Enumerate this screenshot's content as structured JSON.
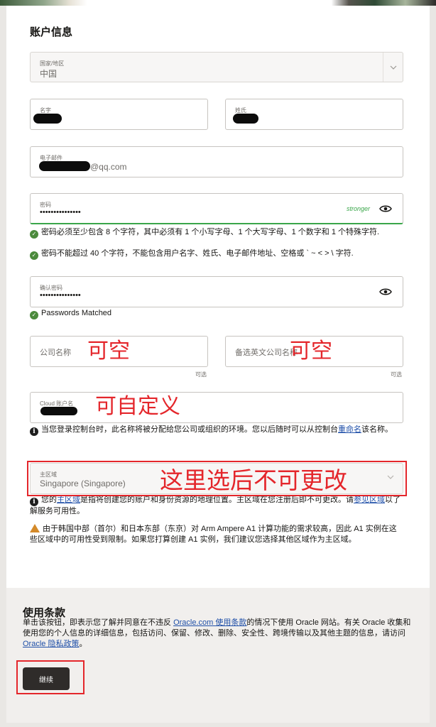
{
  "section_title": "账户信息",
  "country": {
    "label": "国家/地区",
    "value": "中国"
  },
  "first_name": {
    "label": "名字"
  },
  "last_name": {
    "label": "姓氏"
  },
  "email": {
    "label": "电子邮件",
    "suffix": "@qq.com"
  },
  "password": {
    "label": "密码",
    "value": "•••••••••••••••",
    "strength": "stronger",
    "rule1": "密码必须至少包含 8 个字符，其中必须有 1 个小写字母、1 个大写字母、1 个数字和 1 个特殊字符.",
    "rule2": "密码不能超过 40 个字符，不能包含用户名字、姓氏、电子邮件地址、空格或 ` ~ < > \\ 字符."
  },
  "confirm_password": {
    "label": "确认密码",
    "value": "•••••••••••••••",
    "match_msg": "Passwords Matched"
  },
  "company": {
    "placeholder": "公司名称",
    "optional": "可选"
  },
  "alt_company": {
    "placeholder": "备选英文公司名称",
    "optional": "可选"
  },
  "cloud_account": {
    "label": "Cloud 账户名",
    "info_pre": "当您登录控制台时，此名称将被分配给您公司或组织的环境。您以后随时可以从控制台",
    "info_link": "重命名",
    "info_post": "该名称。"
  },
  "home_region": {
    "label": "主区域",
    "value": "Singapore (Singapore)",
    "info_pre": "您的",
    "info_link1": "主区域",
    "info_mid": "是指将创建您的账户和身份资源的地理位置。主区域在您注册后即不可更改。请",
    "info_link2": "参见区域",
    "info_post": "以了解服务可用性。",
    "warning": "由于韩国中部（首尔）和日本东部（东京）对 Arm Ampere A1 计算功能的需求较高，因此 A1 实例在这些区域中的可用性受到限制。如果您打算创建 A1 实例，我们建议您选择其他区域作为主区域。"
  },
  "annotations": {
    "company": "可空",
    "alt_company": "可空",
    "cloud_account": "可自定义",
    "region": "这里选后不可更改",
    "color": "#e4262b"
  },
  "terms": {
    "title": "使用条款",
    "text_pre": "单击该按钮，即表示您了解并同意在不违反 ",
    "link1": "Oracle.com 使用条款",
    "text_mid": "的情况下使用 Oracle 网站。有关 Oracle 收集和使用您的个人信息的详细信息，包括访问、保留、修改、删除、安全性、跨境传输以及其他主题的信息，请访问 ",
    "link2": "Oracle 隐私政策",
    "text_post": "。",
    "button": "继续"
  }
}
